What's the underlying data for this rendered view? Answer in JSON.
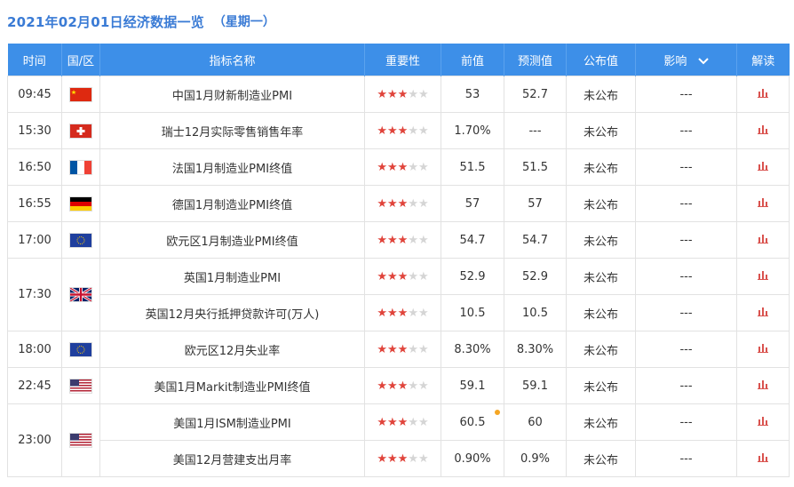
{
  "header": {
    "title": "2021年02月01日经济数据一览",
    "weekday": "（星期一）"
  },
  "columns": [
    "时间",
    "国/区",
    "指标名称",
    "重要性",
    "前值",
    "预测值",
    "公布值",
    "影响",
    "解读"
  ],
  "rows": [
    {
      "time": "09:45",
      "country": "china-flag",
      "name": "中国1月财新制造业PMI",
      "stars": 3,
      "prev": "53",
      "forecast": "52.7",
      "actual": "未公布",
      "impact": "---"
    },
    {
      "time": "15:30",
      "country": "switzerland-flag",
      "name": "瑞士12月实际零售销售年率",
      "stars": 3,
      "prev": "1.70%",
      "forecast": "---",
      "actual": "未公布",
      "impact": "---"
    },
    {
      "time": "16:50",
      "country": "france-flag",
      "name": "法国1月制造业PMI终值",
      "stars": 3,
      "prev": "51.5",
      "forecast": "51.5",
      "actual": "未公布",
      "impact": "---"
    },
    {
      "time": "16:55",
      "country": "germany-flag",
      "name": "德国1月制造业PMI终值",
      "stars": 3,
      "prev": "57",
      "forecast": "57",
      "actual": "未公布",
      "impact": "---"
    },
    {
      "time": "17:00",
      "country": "eu-flag",
      "name": "欧元区1月制造业PMI终值",
      "stars": 3,
      "prev": "54.7",
      "forecast": "54.7",
      "actual": "未公布",
      "impact": "---"
    },
    {
      "time": "17:30",
      "country": "uk-flag",
      "name": "英国1月制造业PMI",
      "stars": 3,
      "prev": "52.9",
      "forecast": "52.9",
      "actual": "未公布",
      "impact": "---"
    },
    {
      "time": "",
      "country": "",
      "name": "英国12月央行抵押贷款许可(万人)",
      "stars": 3,
      "prev": "10.5",
      "forecast": "10.5",
      "actual": "未公布",
      "impact": "---"
    },
    {
      "time": "18:00",
      "country": "eu-flag",
      "name": "欧元区12月失业率",
      "stars": 3,
      "prev": "8.30%",
      "forecast": "8.30%",
      "actual": "未公布",
      "impact": "---"
    },
    {
      "time": "22:45",
      "country": "us-flag",
      "name": "美国1月Markit制造业PMI终值",
      "stars": 3,
      "prev": "59.1",
      "forecast": "59.1",
      "actual": "未公布",
      "impact": "---"
    },
    {
      "time": "23:00",
      "country": "us-flag",
      "name": "美国1月ISM制造业PMI",
      "stars": 3,
      "prev": "60.5",
      "forecast": "60",
      "actual": "未公布",
      "impact": "---"
    },
    {
      "time": "",
      "country": "",
      "name": "美国12月营建支出月率",
      "stars": 3,
      "prev": "0.90%",
      "forecast": "0.9%",
      "actual": "未公布",
      "impact": "---"
    }
  ],
  "colors": {
    "header_bg": "#3d8fe8",
    "title": "#3a7bd5",
    "value_red": "#d9534f",
    "star_on": "#e0443b",
    "star_off": "#d5d5d5"
  }
}
